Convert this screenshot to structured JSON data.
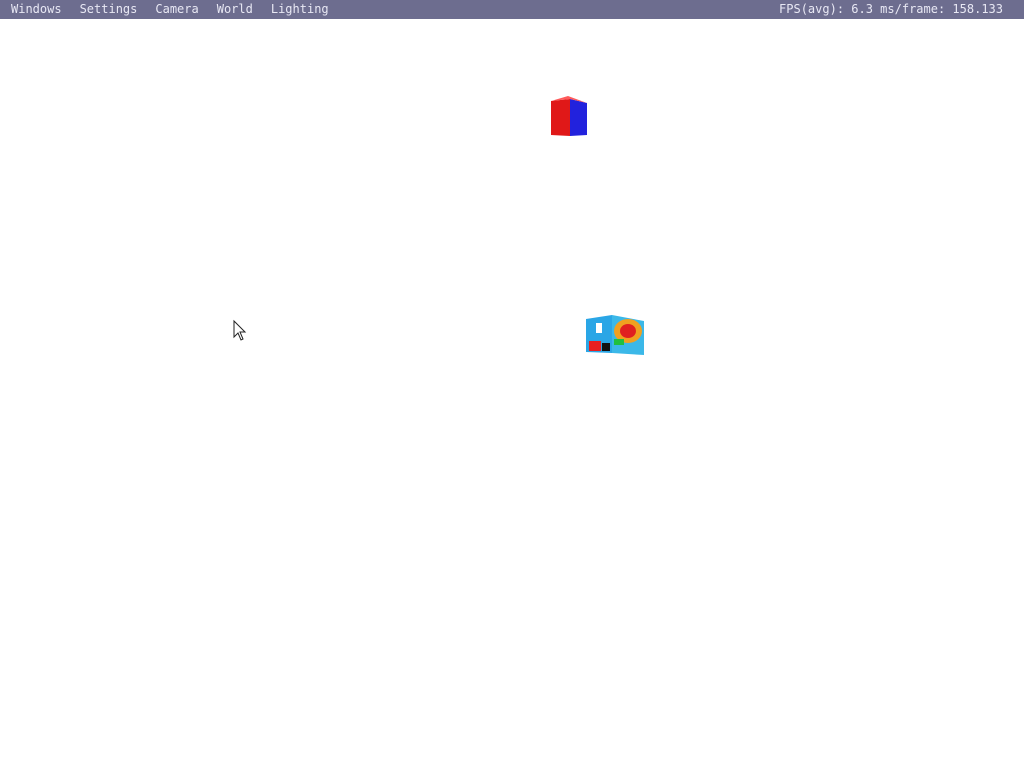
{
  "menubar": {
    "items": [
      {
        "label": "Windows"
      },
      {
        "label": "Settings"
      },
      {
        "label": "Camera"
      },
      {
        "label": "World"
      },
      {
        "label": "Lighting"
      }
    ],
    "fps_text": "FPS(avg): 6.3 ms/frame: 158.133"
  },
  "colors": {
    "menubar_bg": "#6d6d8f",
    "menubar_text": "#e8e8f4",
    "ground_marker": "#1e5a1e",
    "hash_near": "#1414c8",
    "hash_far": "#e06ee0",
    "cube_red": "#e01818",
    "cube_blue": "#2222dd"
  },
  "icons": {
    "cursor": "mouse-pointer-icon",
    "ground": "x-marker-icon",
    "objects": "hash-cluster-icon"
  }
}
